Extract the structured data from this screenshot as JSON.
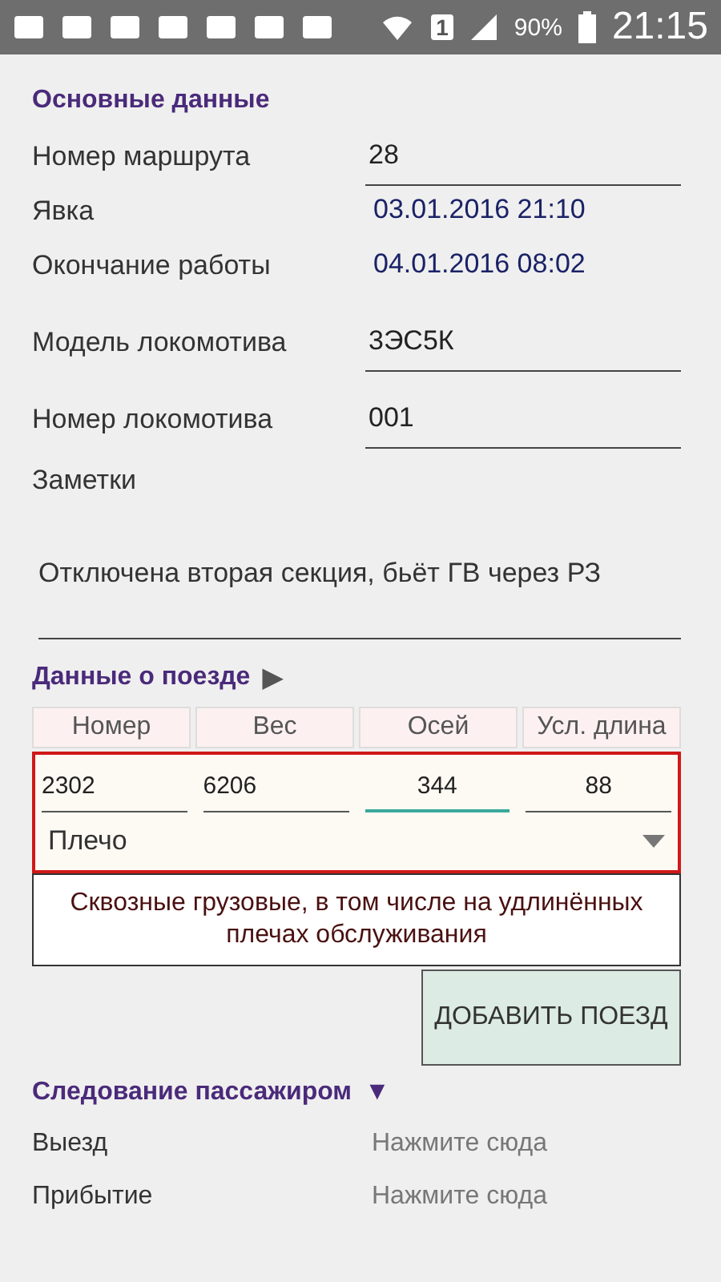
{
  "status_bar": {
    "battery": "90%",
    "time": "21:15",
    "sim": "1"
  },
  "main": {
    "title": "Основные данные",
    "fields": [
      {
        "label": "Номер маршрута",
        "value": "28",
        "kind": "input"
      },
      {
        "label": "Явка",
        "value": "03.01.2016 21:10",
        "kind": "datetime"
      },
      {
        "label": "Окончание работы",
        "value": "04.01.2016 08:02",
        "kind": "datetime"
      },
      {
        "label": "Модель локомотива",
        "value": "3ЭС5К",
        "kind": "input"
      },
      {
        "label": "Номер локомотива",
        "value": "001",
        "kind": "input"
      }
    ],
    "notes_label": "Заметки",
    "notes": "Отключена вторая секция, бьёт ГВ через РЗ"
  },
  "train": {
    "title": "Данные о поезде",
    "arrow": "▶",
    "columns": [
      "Номер",
      "Вес",
      "Осей",
      "Усл. длина"
    ],
    "values": [
      {
        "value": "2302",
        "focused": false
      },
      {
        "value": "6206",
        "focused": false
      },
      {
        "value": "344",
        "focused": true
      },
      {
        "value": "88",
        "focused": false
      }
    ],
    "route": "Плечо",
    "description": "Сквозные грузовые, в том числе на удлинённых плечах обслуживания",
    "add_button": "ДОБАВИТЬ ПОЕЗД"
  },
  "passenger": {
    "title": "Следование пассажиром",
    "arrow": "▼",
    "rows": [
      {
        "label": "Выезд",
        "hint": "Нажмите сюда"
      },
      {
        "label": "Прибытие",
        "hint": "Нажмите сюда"
      }
    ]
  }
}
